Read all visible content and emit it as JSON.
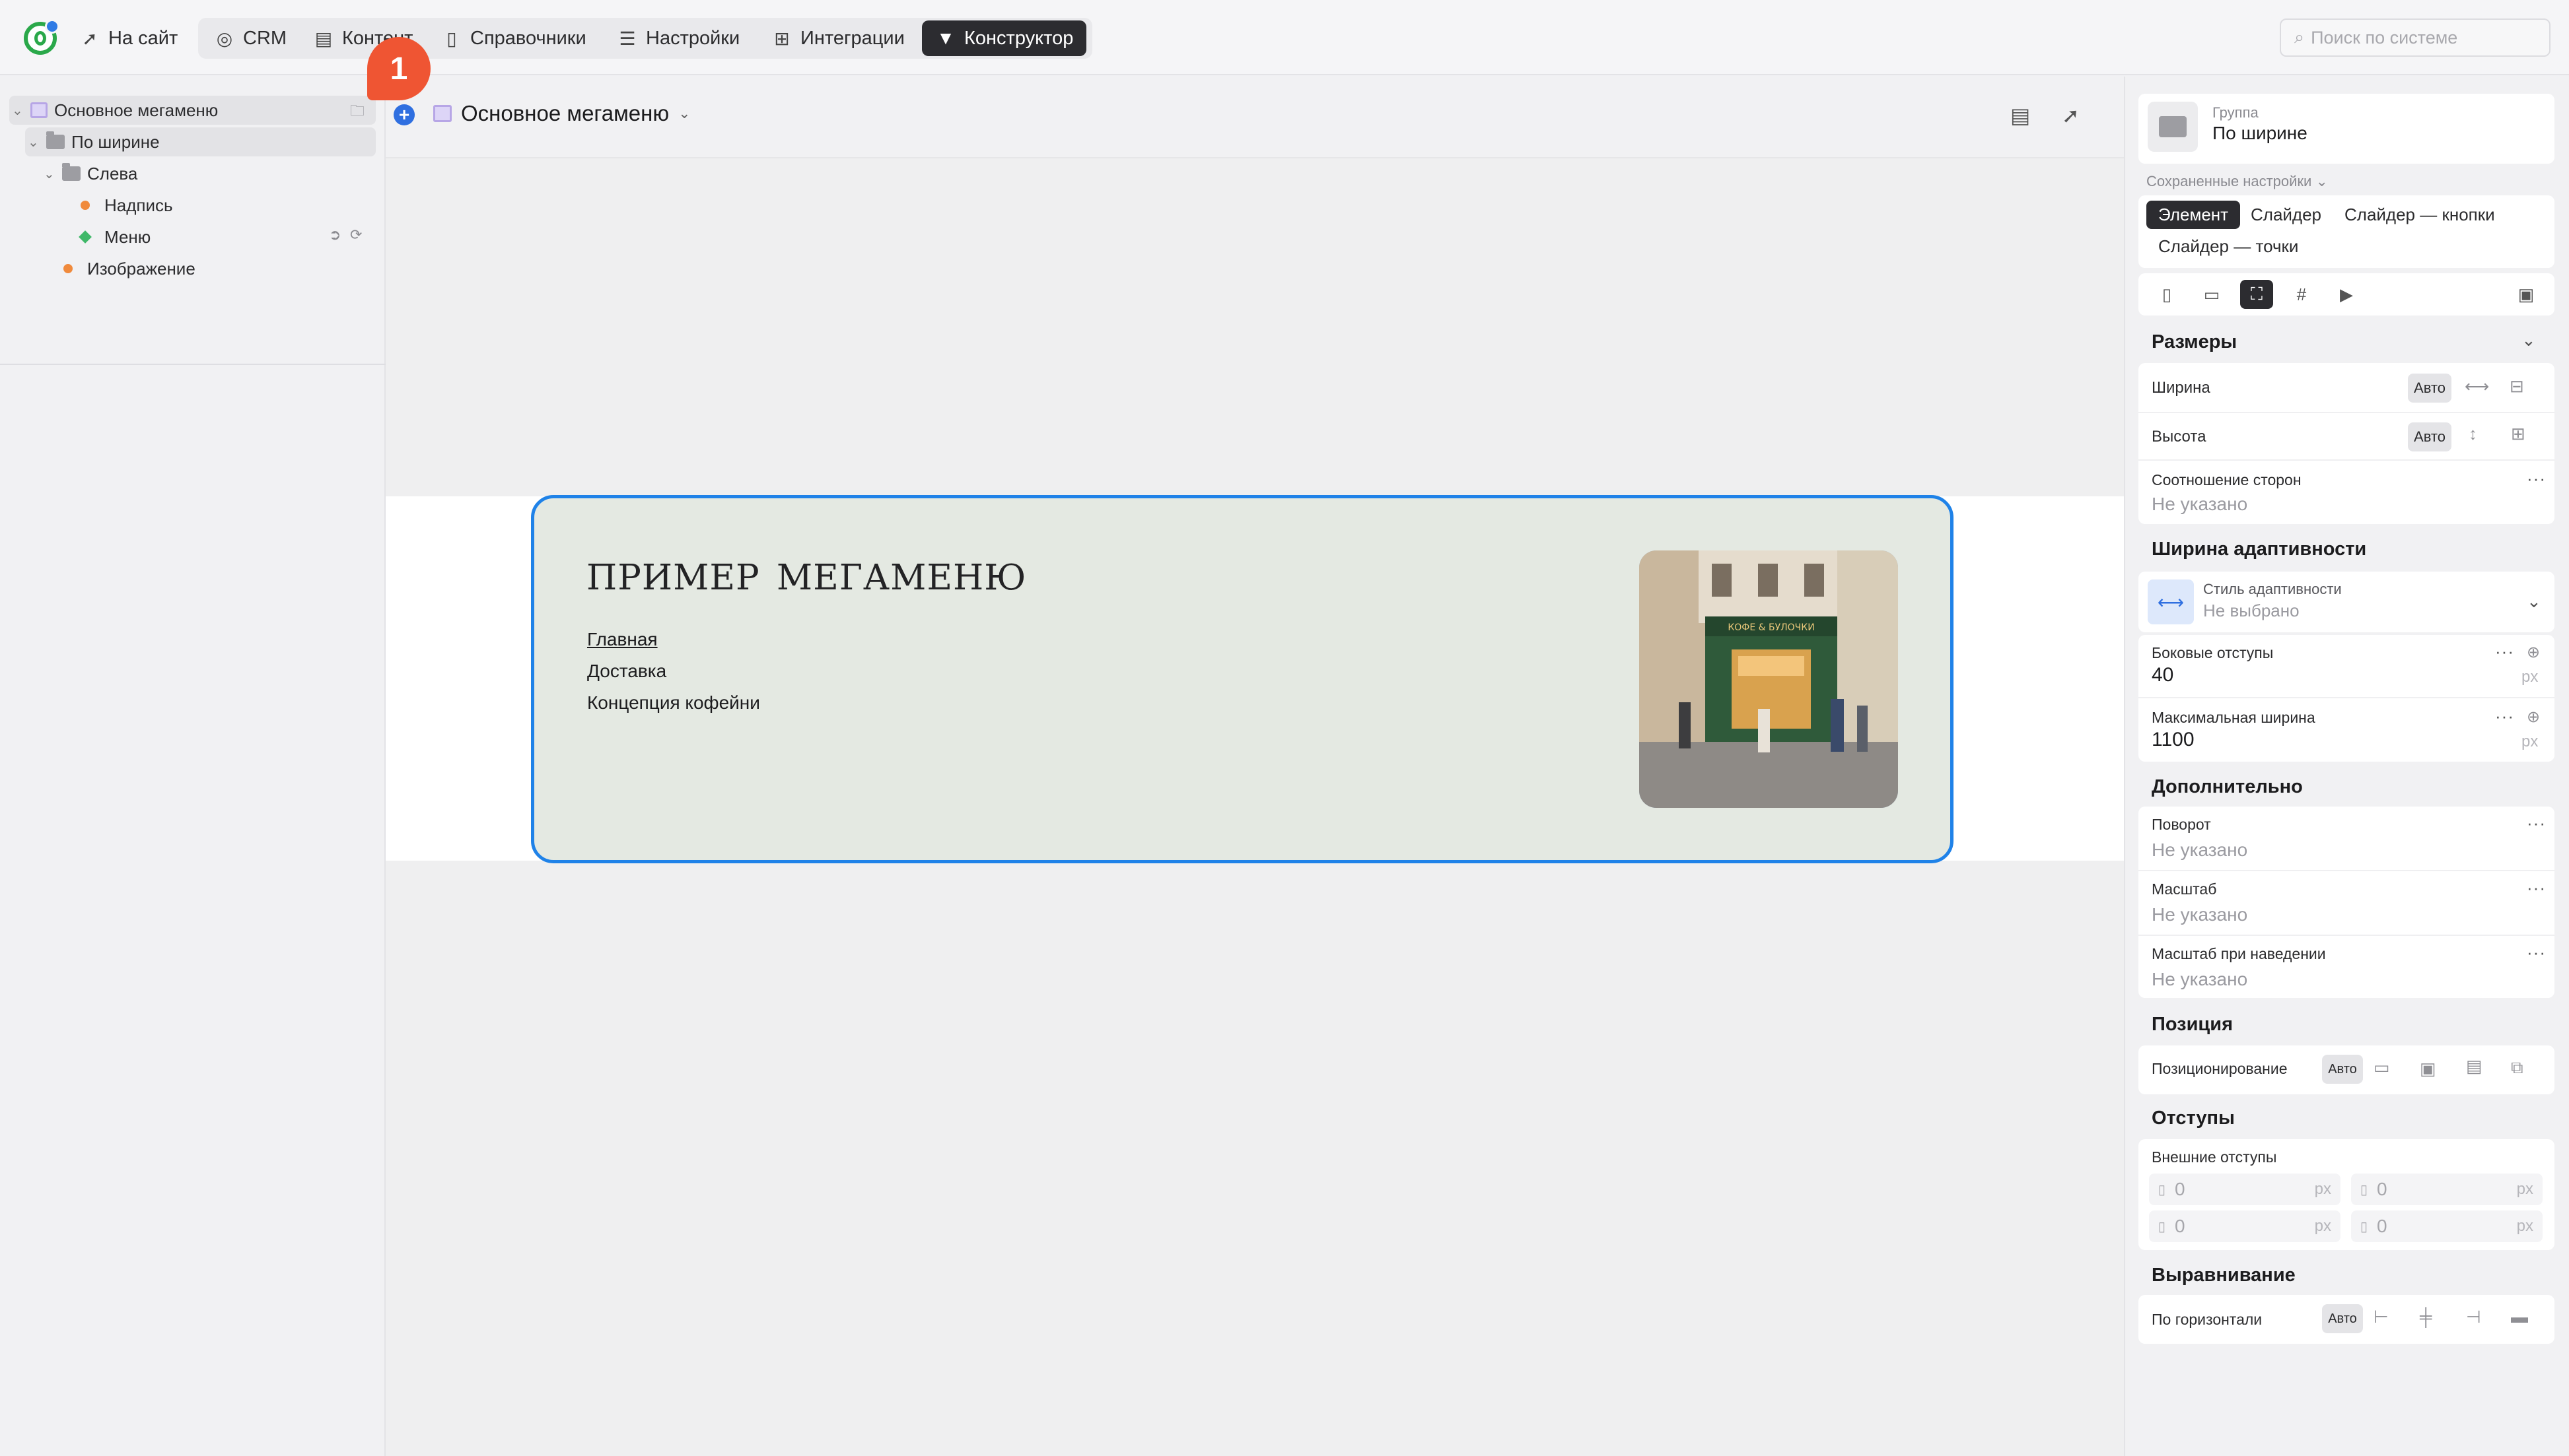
{
  "topbar": {
    "nav": [
      {
        "label": "На сайт",
        "icon": "external-link-icon"
      },
      {
        "label": "CRM",
        "icon": "crm-icon"
      },
      {
        "label": "Контент",
        "icon": "content-icon"
      },
      {
        "label": "Справочники",
        "icon": "book-icon"
      },
      {
        "label": "Настройки",
        "icon": "settings-sliders-icon"
      },
      {
        "label": "Интеграции",
        "icon": "plus-box-icon"
      },
      {
        "label": "Конструктор",
        "icon": "constructor-icon"
      }
    ],
    "active_nav": "Конструктор",
    "search_placeholder": "Поиск по системе"
  },
  "tree": {
    "items": [
      {
        "label": "Основное мегаменю",
        "level": 0,
        "kind": "component"
      },
      {
        "label": "По ширине",
        "level": 1,
        "kind": "folder"
      },
      {
        "label": "Слева",
        "level": 2,
        "kind": "folder"
      },
      {
        "label": "Надпись",
        "level": 3,
        "kind": "text"
      },
      {
        "label": "Меню",
        "level": 3,
        "kind": "menu"
      },
      {
        "label": "Изображение",
        "level": 2,
        "kind": "image"
      }
    ],
    "badge": "1"
  },
  "canvas": {
    "title": "Основное мегаменю",
    "mega": {
      "heading": "пример мегаменю",
      "links": [
        "Главная",
        "Доставка",
        "Концепция кофейни"
      ]
    },
    "photo": {
      "sign": "КОФЕ & БУЛОЧКИ"
    }
  },
  "panel": {
    "group_type": "Группа",
    "group_name": "По ширине",
    "saved_settings": "Сохраненные настройки",
    "tabs": [
      "Элемент",
      "Слайдер",
      "Слайдер — кнопки",
      "Слайдер — точки"
    ],
    "active_tab": "Элемент",
    "sizes": {
      "title": "Размеры",
      "width_label": "Ширина",
      "height_label": "Высота",
      "auto": "Авто",
      "ratio_label": "Соотношение сторон",
      "ratio_value": "Не указано"
    },
    "adaptive": {
      "title": "Ширина адаптивности",
      "style_label": "Стиль адаптивности",
      "style_value": "Не выбрано",
      "side_label": "Боковые отступы",
      "side_value": "40",
      "max_label": "Максимальная ширина",
      "max_value": "1100",
      "unit": "px"
    },
    "extra": {
      "title": "Дополнительно",
      "rotate_label": "Поворот",
      "rotate_value": "Не указано",
      "scale_label": "Масштаб",
      "scale_value": "Не указано",
      "hover_label": "Масштаб при наведении",
      "hover_value": "Не указано"
    },
    "position": {
      "title": "Позиция",
      "label": "Позиционирование",
      "auto": "Авто"
    },
    "margins": {
      "title": "Отступы",
      "outer_label": "Внешние отступы",
      "values": [
        "0",
        "0",
        "0",
        "0"
      ],
      "unit": "px"
    },
    "align": {
      "title": "Выравнивание",
      "label": "По горизонтали",
      "auto": "Авто"
    },
    "colors": {
      "accent": "#1f82e8",
      "badge": "#ef5533",
      "active_dark": "#2c2c30"
    }
  }
}
